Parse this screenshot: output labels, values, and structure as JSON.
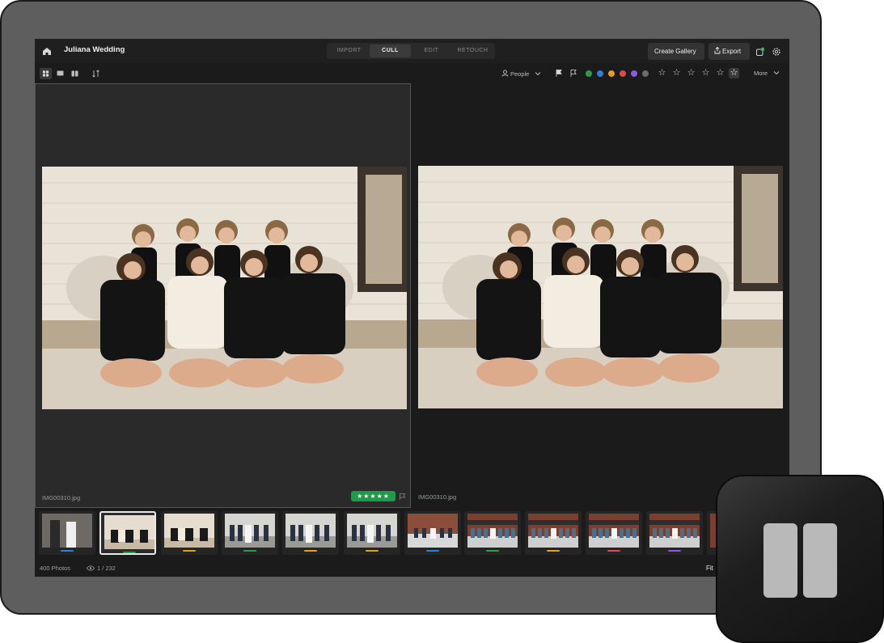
{
  "header": {
    "title": "Juliana Wedding",
    "create_gallery": "Create Gallery",
    "export": "Export"
  },
  "modes": [
    "IMPORT",
    "CULL",
    "EDIT",
    "RETOUCH"
  ],
  "active_mode": "CULL",
  "toolbar": {
    "people": "People",
    "more": "More"
  },
  "color_labels": [
    "#2e9b4e",
    "#2f7fd6",
    "#e0a020",
    "#e0484b",
    "#8a5ae0",
    "#6c6c6c"
  ],
  "left_pane": {
    "filename": "IMG00310.jpg",
    "rating": "★★★★★"
  },
  "right_pane": {
    "filename": "IMG00310.jpg"
  },
  "filmstrip_tags": [
    "#2f7fd6",
    "#2e9b4e",
    "#e0a020",
    "#2e9b4e",
    "#e0a020",
    "#e0a020",
    "#2f7fd6",
    "#2e9b4e",
    "#e0a020",
    "#e0484b",
    "#8a5ae0"
  ],
  "status": {
    "photos": "400 Photos",
    "count": "1 / 232",
    "fit": "Fit"
  }
}
